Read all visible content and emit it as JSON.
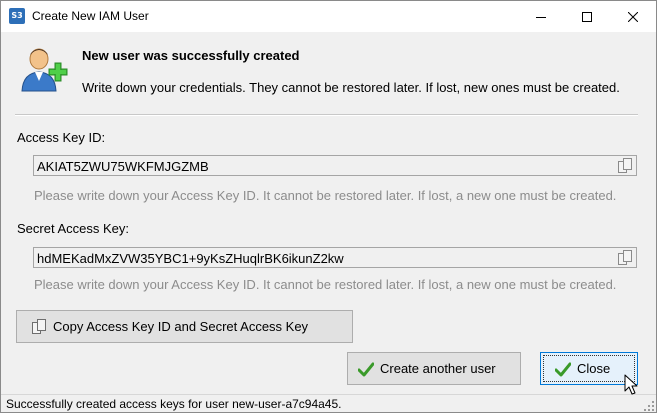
{
  "window": {
    "title": "Create New IAM User",
    "app_icon_text": "S3"
  },
  "header": {
    "title": "New user was successfully created",
    "subtitle": "Write down your credentials. They cannot be restored later. If lost, new ones must be created."
  },
  "access_key": {
    "label": "Access Key ID:",
    "value": "AKIAT5ZWU75WKFMJGZMB",
    "hint": "Please write down your Access Key ID. It cannot be restored later. If lost, a new one must be created."
  },
  "secret_key": {
    "label": "Secret Access Key:",
    "value": "hdMEKadMxZVW35YBC1+9yKsZHuqlrBK6ikunZ2kw",
    "hint": "Please write down your Access Key ID. It cannot be restored later. If lost, a new one must be created."
  },
  "buttons": {
    "copy_both": "Copy Access Key ID and Secret Access Key",
    "create_another": "Create another user",
    "close": "Close"
  },
  "status": {
    "text": "Successfully created access keys for user new-user-a7c94a45."
  },
  "icons": {
    "title_min": "minimize-icon",
    "title_max": "maximize-icon",
    "title_close": "close-icon",
    "header": "user-add-icon",
    "copy": "copy-icon",
    "check": "checkmark-icon"
  },
  "colors": {
    "accent_border": "#0078d7",
    "close_bg": "#e5f1fb",
    "hint_text": "#8c8c8c",
    "check_green": "#3a9a2a"
  }
}
